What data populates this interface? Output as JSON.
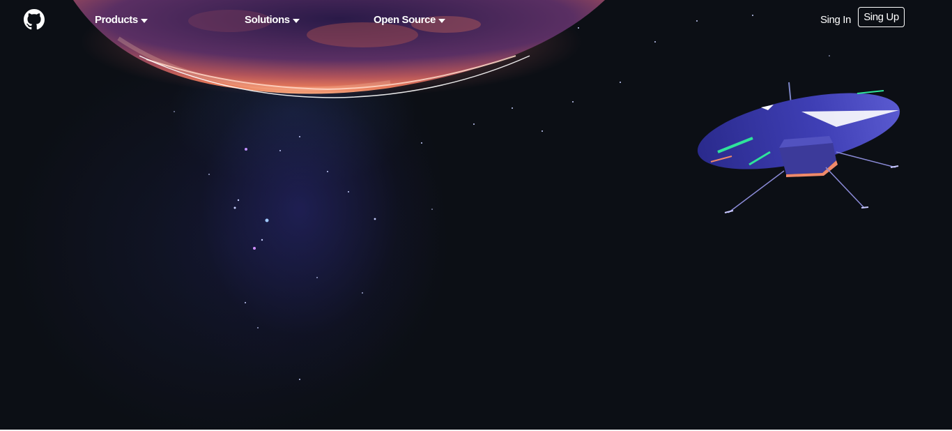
{
  "header": {
    "logo_icon": "github-octocat-icon",
    "nav": [
      {
        "label": "Products",
        "icon": "caret-down-icon"
      },
      {
        "label": "Solutions",
        "icon": "caret-down-icon"
      },
      {
        "label": "Open Source",
        "icon": "caret-down-icon"
      }
    ],
    "signin_label": "Sing In",
    "signup_label": "Sing Up"
  },
  "hero": {
    "background_color": "#0c0f15",
    "planet_color": "#d9694f",
    "illustration": "mars-helicopter"
  }
}
